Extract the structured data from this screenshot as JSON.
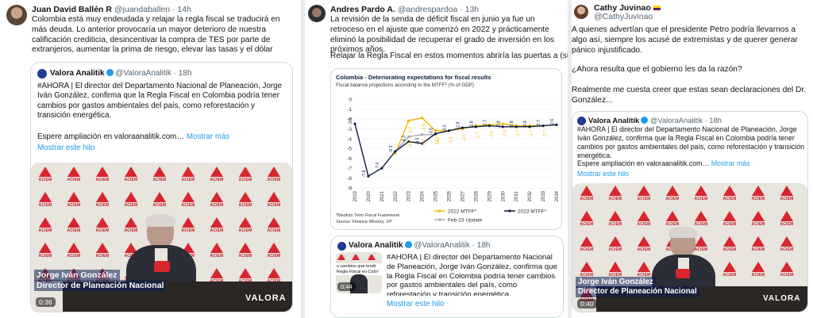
{
  "tweet1": {
    "name": "Juan David Ballén R",
    "handle": "@juandaballen",
    "time": "· 14h",
    "text": "Colombia está muy endeudada y relajar la regla fiscal se traducirá en más deuda. Lo anterior provocaría un mayor deterioro de nuestra calificación crediticia, desincentivar la compra de TES por parte de extranjeros, aumentar la prima de riesgo, elevar las tasas y el dólar",
    "quote": {
      "name": "Valora Analitik",
      "handle": "@ValoraAnalitik",
      "time": "· 18h",
      "text": "#AHORA | El director del Departamento Nacional de Planeación, Jorge Iván González, confirma que la Regla Fiscal en Colombia podría tener cambios por gastos ambientales del país, como reforestación y transición energética.",
      "text2": "Espere ampliación en valoraanalitik.com…",
      "more": "Mostrar más",
      "thread": "Mostrar este hilo",
      "chyron1": "Jorge Iván González",
      "chyron2": "Director de Planeación Nacional",
      "duration": "0:36",
      "brand": "VALORA",
      "brand_sub": "ANALITIK"
    }
  },
  "tweet2": {
    "name": "Andres Pardo A.",
    "handle": "@andrespardoa",
    "time": "· 13h",
    "text": "La revisión de la senda de déficit fiscal en junio ya fue un retroceso en el ajuste que comenzó en 2022 y prácticamente eliminó la posibilidad de recuperar el grado de inversión en los próximos años.",
    "text2": "Relajar la Regla Fiscal en estos momentos abriría las puertas a (sigue...) 👇",
    "quote": {
      "name": "Valora Analitik",
      "handle": "@ValoraAnalitik",
      "time": "· 18h",
      "text": "#AHORA | El director del Departamento Nacional de Planeación, Jorge Iván González, confirma que la Regla Fiscal en Colombia podría tener cambios por gastos ambientales del país, como reforestación y transición energética.",
      "thread": "Mostrar este hilo",
      "thumb_caption": "s cambios que tendr Regla Fiscal en Color",
      "duration": "0:44"
    }
  },
  "tweet3": {
    "name": "Cathy Juvinao",
    "handle": "@CathyJuvinao",
    "text1": "A quienes advertían que el presidente Petro podría llevarnos a algo así, siempre los acusé de extremistas y de querer generar pánico injustificado.",
    "text2": "¿Ahora resulta que el gobierno les da la razón?",
    "text3": "Realmente me cuesta creer que estas sean declaraciones del Dr. González...",
    "quote": {
      "name": "Valora Analitik",
      "handle": "@ValoraAnalitik",
      "time": "· 18h",
      "text": "#AHORA | El director del Departamento Nacional de Planeación, Jorge Iván González, confirma que la Regla Fiscal en Colombia podría tener cambios por gastos ambientales del país, como reforestación y transición energética.",
      "text2": "Espere ampliación en valoraanalitik.com…",
      "more": "Mostrar más",
      "thread": "Mostrar este hilo",
      "chyron1": "Jorge Iván González",
      "chyron2": "Director de Planeación Nacional",
      "duration": "0:40",
      "brand": "VALORA",
      "brand_sub": "ANALITIK"
    }
  },
  "banner_label": "ACIEM",
  "colors": {
    "accent": "#1d9bf0",
    "gold": "#f2b705",
    "navy": "#0d1b3e",
    "grey": "#a6a6a6",
    "red": "#d7262e"
  },
  "chart_data": {
    "type": "line",
    "title": "Colombia - Deteriorating expectations for fiscal results",
    "subtitle": "Fiscal balance projections according to the MTFF* (% of GDP)",
    "x": [
      "2019",
      "2020",
      "2021",
      "2022",
      "2023",
      "2024",
      "2025",
      "2026",
      "2027",
      "2028",
      "2029",
      "2030",
      "2031",
      "2032",
      "2033",
      "2034"
    ],
    "ylim": [
      -9,
      0
    ],
    "yticks": [
      0,
      -1,
      -2,
      -3,
      -4,
      -5,
      -6,
      -7,
      -8,
      -9
    ],
    "series": [
      {
        "name": "2022 MTFF*",
        "color": "#f2b705",
        "values": [
          null,
          null,
          null,
          -5.5,
          -2.2,
          -1.9,
          -3.2,
          -3.2,
          -3.0,
          -2.7,
          -2.6,
          -2.5,
          -2.7,
          -2.7,
          -2.7,
          null
        ]
      },
      {
        "name": "Feb-23 Update",
        "color": "#a6a6a6",
        "values": [
          null,
          null,
          null,
          -5.3,
          -3.8,
          -3.6,
          -3.6,
          null,
          null,
          null,
          null,
          null,
          null,
          null,
          null,
          null
        ]
      },
      {
        "name": "2023 MTFF*",
        "color": "#0d1b3e",
        "values": [
          -2.5,
          -7.8,
          -7.0,
          -5.3,
          -4.3,
          -4.5,
          -3.5,
          -3.2,
          -2.9,
          -2.8,
          -2.7,
          -2.8,
          -2.8,
          -2.8,
          -2.7,
          -2.6
        ]
      }
    ],
    "labels_top": [
      "-2.5",
      "-7.8",
      "-7.0",
      "-5.3",
      "-4.3",
      "-4.5",
      "-3.5",
      "-3.2",
      "-2.9",
      "-2.8",
      "-2.7",
      "-2.8",
      "-2.8",
      "-2.8",
      "-2.7",
      "-2.6"
    ],
    "labels_top_alt": [
      "",
      "",
      "",
      "",
      "-3.8",
      "-3.6",
      "-3.6",
      "",
      "",
      "",
      "",
      "",
      "-2.7",
      "-2.7",
      "-2.7",
      ""
    ],
    "gold_labels": [
      "",
      "",
      "",
      "",
      "-2.2",
      "-1.9",
      "-3.2",
      "-3.2",
      "-3.0",
      "-2.7",
      "-2.6",
      "-2.5",
      "",
      "",
      "",
      ""
    ],
    "source1": "*Medium Term Fiscal Framework",
    "source2": "Source: Finance Ministry, XP"
  }
}
